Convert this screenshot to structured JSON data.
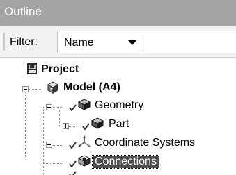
{
  "panel": {
    "title": "Outline"
  },
  "filter": {
    "label": "Filter:",
    "selected": "Name"
  },
  "tree": {
    "project": "Project",
    "model": "Model (A4)",
    "geometry": "Geometry",
    "part": "Part",
    "coordinate_systems": "Coordinate Systems",
    "connections": "Connections"
  },
  "icons": {
    "project": "project-icon",
    "model": "model-icon",
    "geometry": "geometry-icon",
    "part": "part-icon",
    "coordinate_systems": "coordinate-systems-icon",
    "connections": "connections-icon",
    "status": "green-check-icon"
  }
}
